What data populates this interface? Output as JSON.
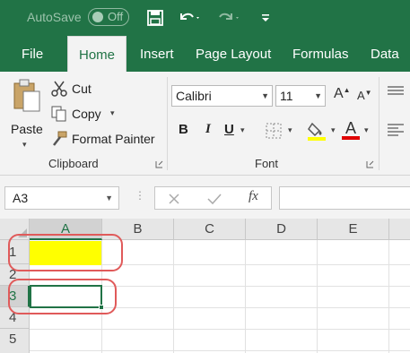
{
  "titlebar": {
    "autosave_label": "AutoSave",
    "toggle_state": "Off",
    "save_icon": "save-icon",
    "undo_icon": "undo-icon",
    "redo_icon": "redo-icon",
    "customize_icon": "customize-qat-icon"
  },
  "tabs": [
    {
      "label": "File",
      "active": false
    },
    {
      "label": "Home",
      "active": true
    },
    {
      "label": "Insert",
      "active": false
    },
    {
      "label": "Page Layout",
      "active": false
    },
    {
      "label": "Formulas",
      "active": false
    },
    {
      "label": "Data",
      "active": false
    }
  ],
  "clipboard": {
    "paste_label": "Paste",
    "cut_label": "Cut",
    "copy_label": "Copy",
    "format_painter_label": "Format Painter",
    "group_label": "Clipboard"
  },
  "font": {
    "font_name": "Calibri",
    "font_size": "11",
    "bold_label": "B",
    "italic_label": "I",
    "underline_label": "U",
    "font_color_label": "A",
    "group_label": "Font",
    "highlight_color": "#ffff00",
    "font_color": "#e00000"
  },
  "formula_bar": {
    "name_box": "A3",
    "fx_label": "fx",
    "formula_value": ""
  },
  "sheet": {
    "columns": [
      "A",
      "B",
      "C",
      "D",
      "E"
    ],
    "rows": [
      "1",
      "2",
      "3",
      "4",
      "5"
    ],
    "selected_column": "A",
    "selected_row": "3",
    "highlighted_cell": "A1",
    "active_cell": "A3"
  },
  "colors": {
    "accent": "#217346",
    "highlight": "#ffff00",
    "annotation": "#e05a5a"
  }
}
